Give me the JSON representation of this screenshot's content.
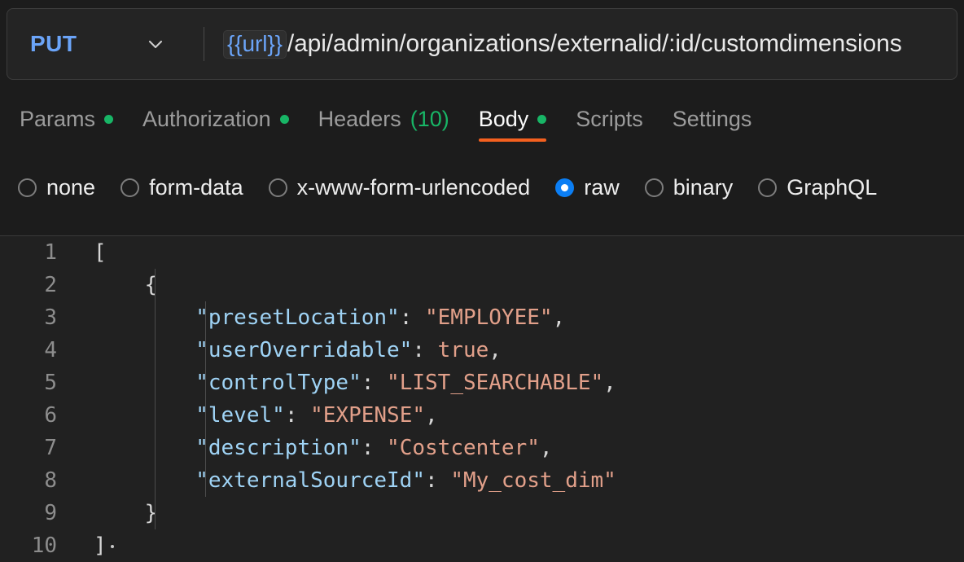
{
  "request": {
    "method": "PUT",
    "method_icon": "chevron-down-icon",
    "url_variable": "{{url}}",
    "url_path": "/api/admin/organizations/externalid/:id/customdimensions"
  },
  "colors": {
    "accent_orange": "#f4601f",
    "accent_blue": "#0b7ef4",
    "method_blue": "#6ba4f8",
    "dot_green": "#18b566",
    "json_key": "#9fd3f5",
    "json_value": "#e2a08a",
    "editor_bg": "#212121",
    "app_bg": "#1c1c1c"
  },
  "tabs": [
    {
      "label": "Params",
      "badge": "dot",
      "count": "",
      "active": false
    },
    {
      "label": "Authorization",
      "badge": "dot",
      "count": "",
      "active": false
    },
    {
      "label": "Headers",
      "badge": "count",
      "count": "(10)",
      "active": false
    },
    {
      "label": "Body",
      "badge": "dot",
      "count": "",
      "active": true
    },
    {
      "label": "Scripts",
      "badge": "none",
      "count": "",
      "active": false
    },
    {
      "label": "Settings",
      "badge": "none",
      "count": "",
      "active": false
    }
  ],
  "body_types": [
    {
      "label": "none",
      "selected": false
    },
    {
      "label": "form-data",
      "selected": false
    },
    {
      "label": "x-www-form-urlencoded",
      "selected": false
    },
    {
      "label": "raw",
      "selected": true
    },
    {
      "label": "binary",
      "selected": false
    },
    {
      "label": "GraphQL",
      "selected": false
    }
  ],
  "editor": {
    "language": "json",
    "lines": [
      {
        "n": "1",
        "indent": 0,
        "tokens": [
          {
            "t": "[",
            "c": "p"
          }
        ]
      },
      {
        "n": "2",
        "indent": 1,
        "tokens": [
          {
            "t": "    {",
            "c": "p"
          }
        ]
      },
      {
        "n": "3",
        "indent": 2,
        "tokens": [
          {
            "t": "        \"presetLocation\"",
            "c": "k"
          },
          {
            "t": ": ",
            "c": "p"
          },
          {
            "t": "\"EMPLOYEE\"",
            "c": "v"
          },
          {
            "t": ",",
            "c": "p"
          }
        ]
      },
      {
        "n": "4",
        "indent": 2,
        "tokens": [
          {
            "t": "        \"userOverridable\"",
            "c": "k"
          },
          {
            "t": ": ",
            "c": "p"
          },
          {
            "t": "true",
            "c": "v"
          },
          {
            "t": ",",
            "c": "p"
          }
        ]
      },
      {
        "n": "5",
        "indent": 2,
        "tokens": [
          {
            "t": "        \"controlType\"",
            "c": "k"
          },
          {
            "t": ": ",
            "c": "p"
          },
          {
            "t": "\"LIST_SEARCHABLE\"",
            "c": "v"
          },
          {
            "t": ",",
            "c": "p"
          }
        ]
      },
      {
        "n": "6",
        "indent": 2,
        "tokens": [
          {
            "t": "        \"level\"",
            "c": "k"
          },
          {
            "t": ": ",
            "c": "p"
          },
          {
            "t": "\"EXPENSE\"",
            "c": "v"
          },
          {
            "t": ",",
            "c": "p"
          }
        ]
      },
      {
        "n": "7",
        "indent": 2,
        "tokens": [
          {
            "t": "        \"description\"",
            "c": "k"
          },
          {
            "t": ": ",
            "c": "p"
          },
          {
            "t": "\"Costcenter\"",
            "c": "v"
          },
          {
            "t": ",",
            "c": "p"
          }
        ]
      },
      {
        "n": "8",
        "indent": 2,
        "tokens": [
          {
            "t": "        \"externalSourceId\"",
            "c": "k"
          },
          {
            "t": ": ",
            "c": "p"
          },
          {
            "t": "\"My_cost_dim\"",
            "c": "v"
          }
        ]
      },
      {
        "n": "9",
        "indent": 1,
        "tokens": [
          {
            "t": "    }",
            "c": "p"
          }
        ]
      },
      {
        "n": "10",
        "indent": 0,
        "tokens": [
          {
            "t": "]",
            "c": "p"
          }
        ],
        "caret": true
      }
    ]
  }
}
